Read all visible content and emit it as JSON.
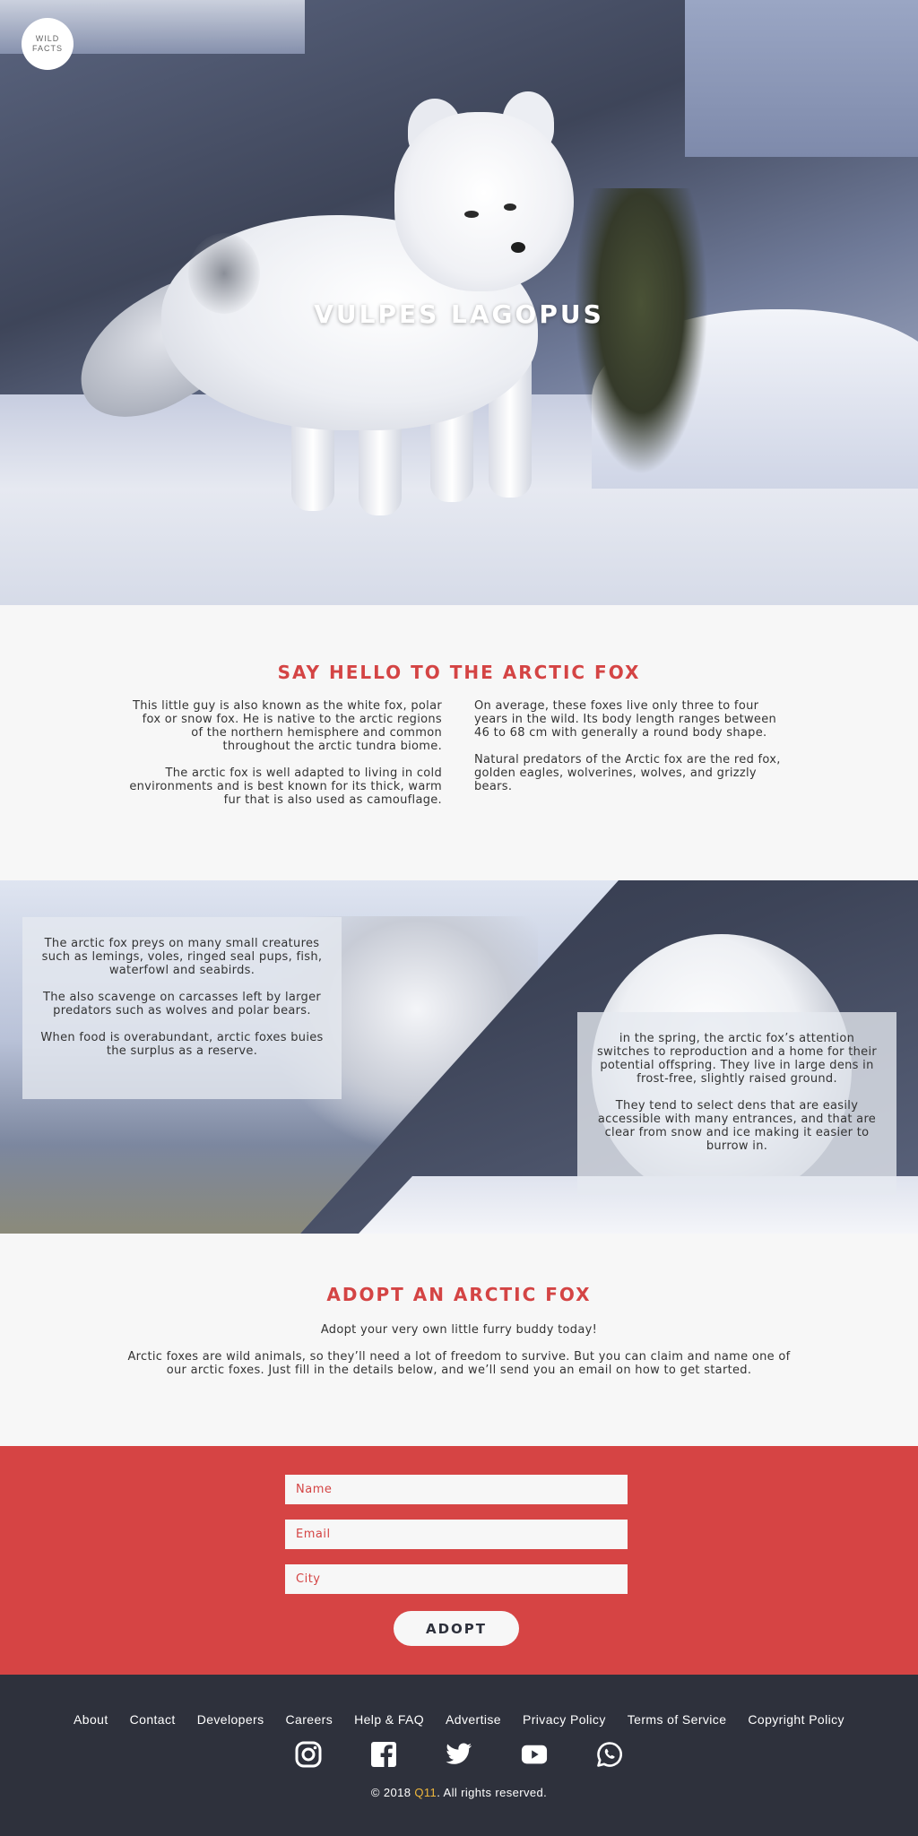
{
  "colors": {
    "accent": "#d64444",
    "footer_bg": "#2e313c",
    "brand_highlight": "#f0b83c"
  },
  "logo": {
    "line1": "WILD",
    "line2": "FACTS"
  },
  "hero": {
    "title": "VULPES LAGOPUS"
  },
  "intro": {
    "title": "SAY HELLO TO THE ARCTIC FOX",
    "left": [
      "This little guy is also known as the white fox, polar fox or snow fox. He is native to the arctic regions of the northern hemisphere and common throughout the arctic tundra biome.",
      "The arctic fox is well adapted to living in cold environments and is best known for its thick, warm fur that is also used as camouflage."
    ],
    "right": [
      "On average, these foxes live only three to four years in the wild. Its body length ranges between 46 to 68 cm with generally a round body shape.",
      "Natural predators of the Arctic fox are the red fox, golden eagles, wolverines, wolves, and grizzly bears."
    ]
  },
  "band": {
    "left": [
      "The arctic fox preys on many small creatures such as lemings, voles, ringed seal pups, fish, waterfowl and seabirds.",
      "The also scavenge on carcasses left by larger predators such as wolves and polar bears.",
      "When food is overabundant, arctic foxes buies the surplus as a reserve."
    ],
    "right": [
      "in the spring, the arctic fox’s attention switches to reproduction and a home for their potential offspring. They live in large dens in frost-free, slightly raised ground.",
      "They tend to select dens that are easily accessible with many entrances, and that are clear from snow and ice making it easier to burrow in."
    ]
  },
  "adopt": {
    "title": "ADOPT AN ARCTIC FOX",
    "subtitle": "Adopt your very own little furry buddy today!",
    "description": "Arctic foxes are wild animals, so they’ll need a lot of freedom to survive. But you can claim and name one of our arctic foxes. Just fill in the details below, and we’ll send you an email on how to get started."
  },
  "form": {
    "name_placeholder": "Name",
    "email_placeholder": "Email",
    "city_placeholder": "City",
    "submit_label": "ADOPT"
  },
  "footer": {
    "links": [
      "About",
      "Contact",
      "Developers",
      "Careers",
      "Help & FAQ",
      "Advertise",
      "Privacy Policy",
      "Terms of Service",
      "Copyright Policy"
    ],
    "socials": [
      "instagram-icon",
      "facebook-icon",
      "twitter-icon",
      "youtube-icon",
      "whatsapp-icon"
    ],
    "copyright_prefix": "© 2018 ",
    "brand": "Q11",
    "copyright_suffix": ". All rights reserved."
  }
}
